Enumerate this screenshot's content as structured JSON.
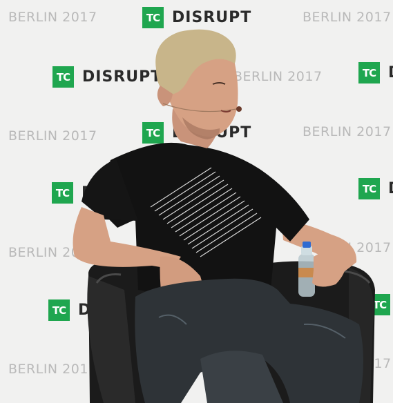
{
  "photo": {
    "backdrop_brand": {
      "logo_text": "TC",
      "event_name": "DISRUPT",
      "event_location_year": "BERLIN 2017"
    },
    "colors": {
      "logo_green": "#1fa64f",
      "backdrop": "#f1f1f0",
      "shirt": "#121212",
      "chair": "#1b1b1b",
      "jeans": "#2e3337",
      "hair": "#c8b58a",
      "skin": "#d6a184"
    },
    "subject": "speaker seated in a black leather armchair holding a water bottle"
  }
}
